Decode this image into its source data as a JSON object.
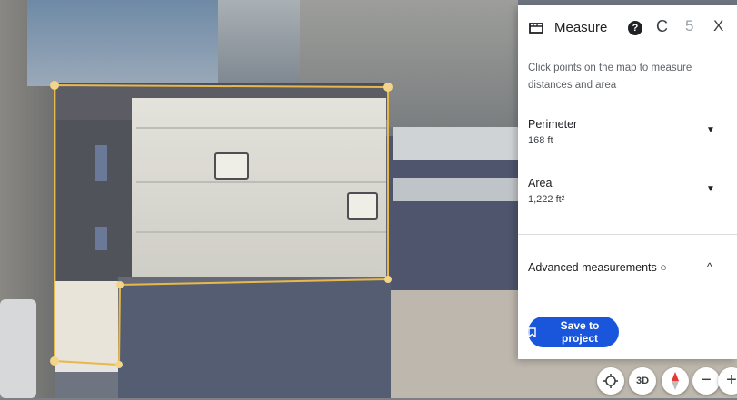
{
  "panel": {
    "title": "Measure",
    "icons": {
      "ruler": "ruler-icon",
      "help": "help-icon",
      "redo": "redo-icon",
      "undo": "undo-icon",
      "close": "close-icon"
    },
    "help_glyph": "?",
    "redo_glyph": "C",
    "undo_glyph": "5",
    "close_glyph": "X",
    "instructions": "Click points on the map to measure distances and area",
    "perimeter": {
      "label": "Perimeter",
      "value": "168 ft"
    },
    "area": {
      "label": "Area",
      "value": "1,222 ft²"
    },
    "advanced": {
      "label": "Advanced measurements ○"
    },
    "save_label": "Save to project"
  },
  "controls": {
    "threed_label": "3D",
    "minus_label": "−",
    "plus_label": "+"
  },
  "colors": {
    "accent": "#1a56db",
    "outline": "#e8b84a",
    "panel_bg": "#ffffff"
  }
}
